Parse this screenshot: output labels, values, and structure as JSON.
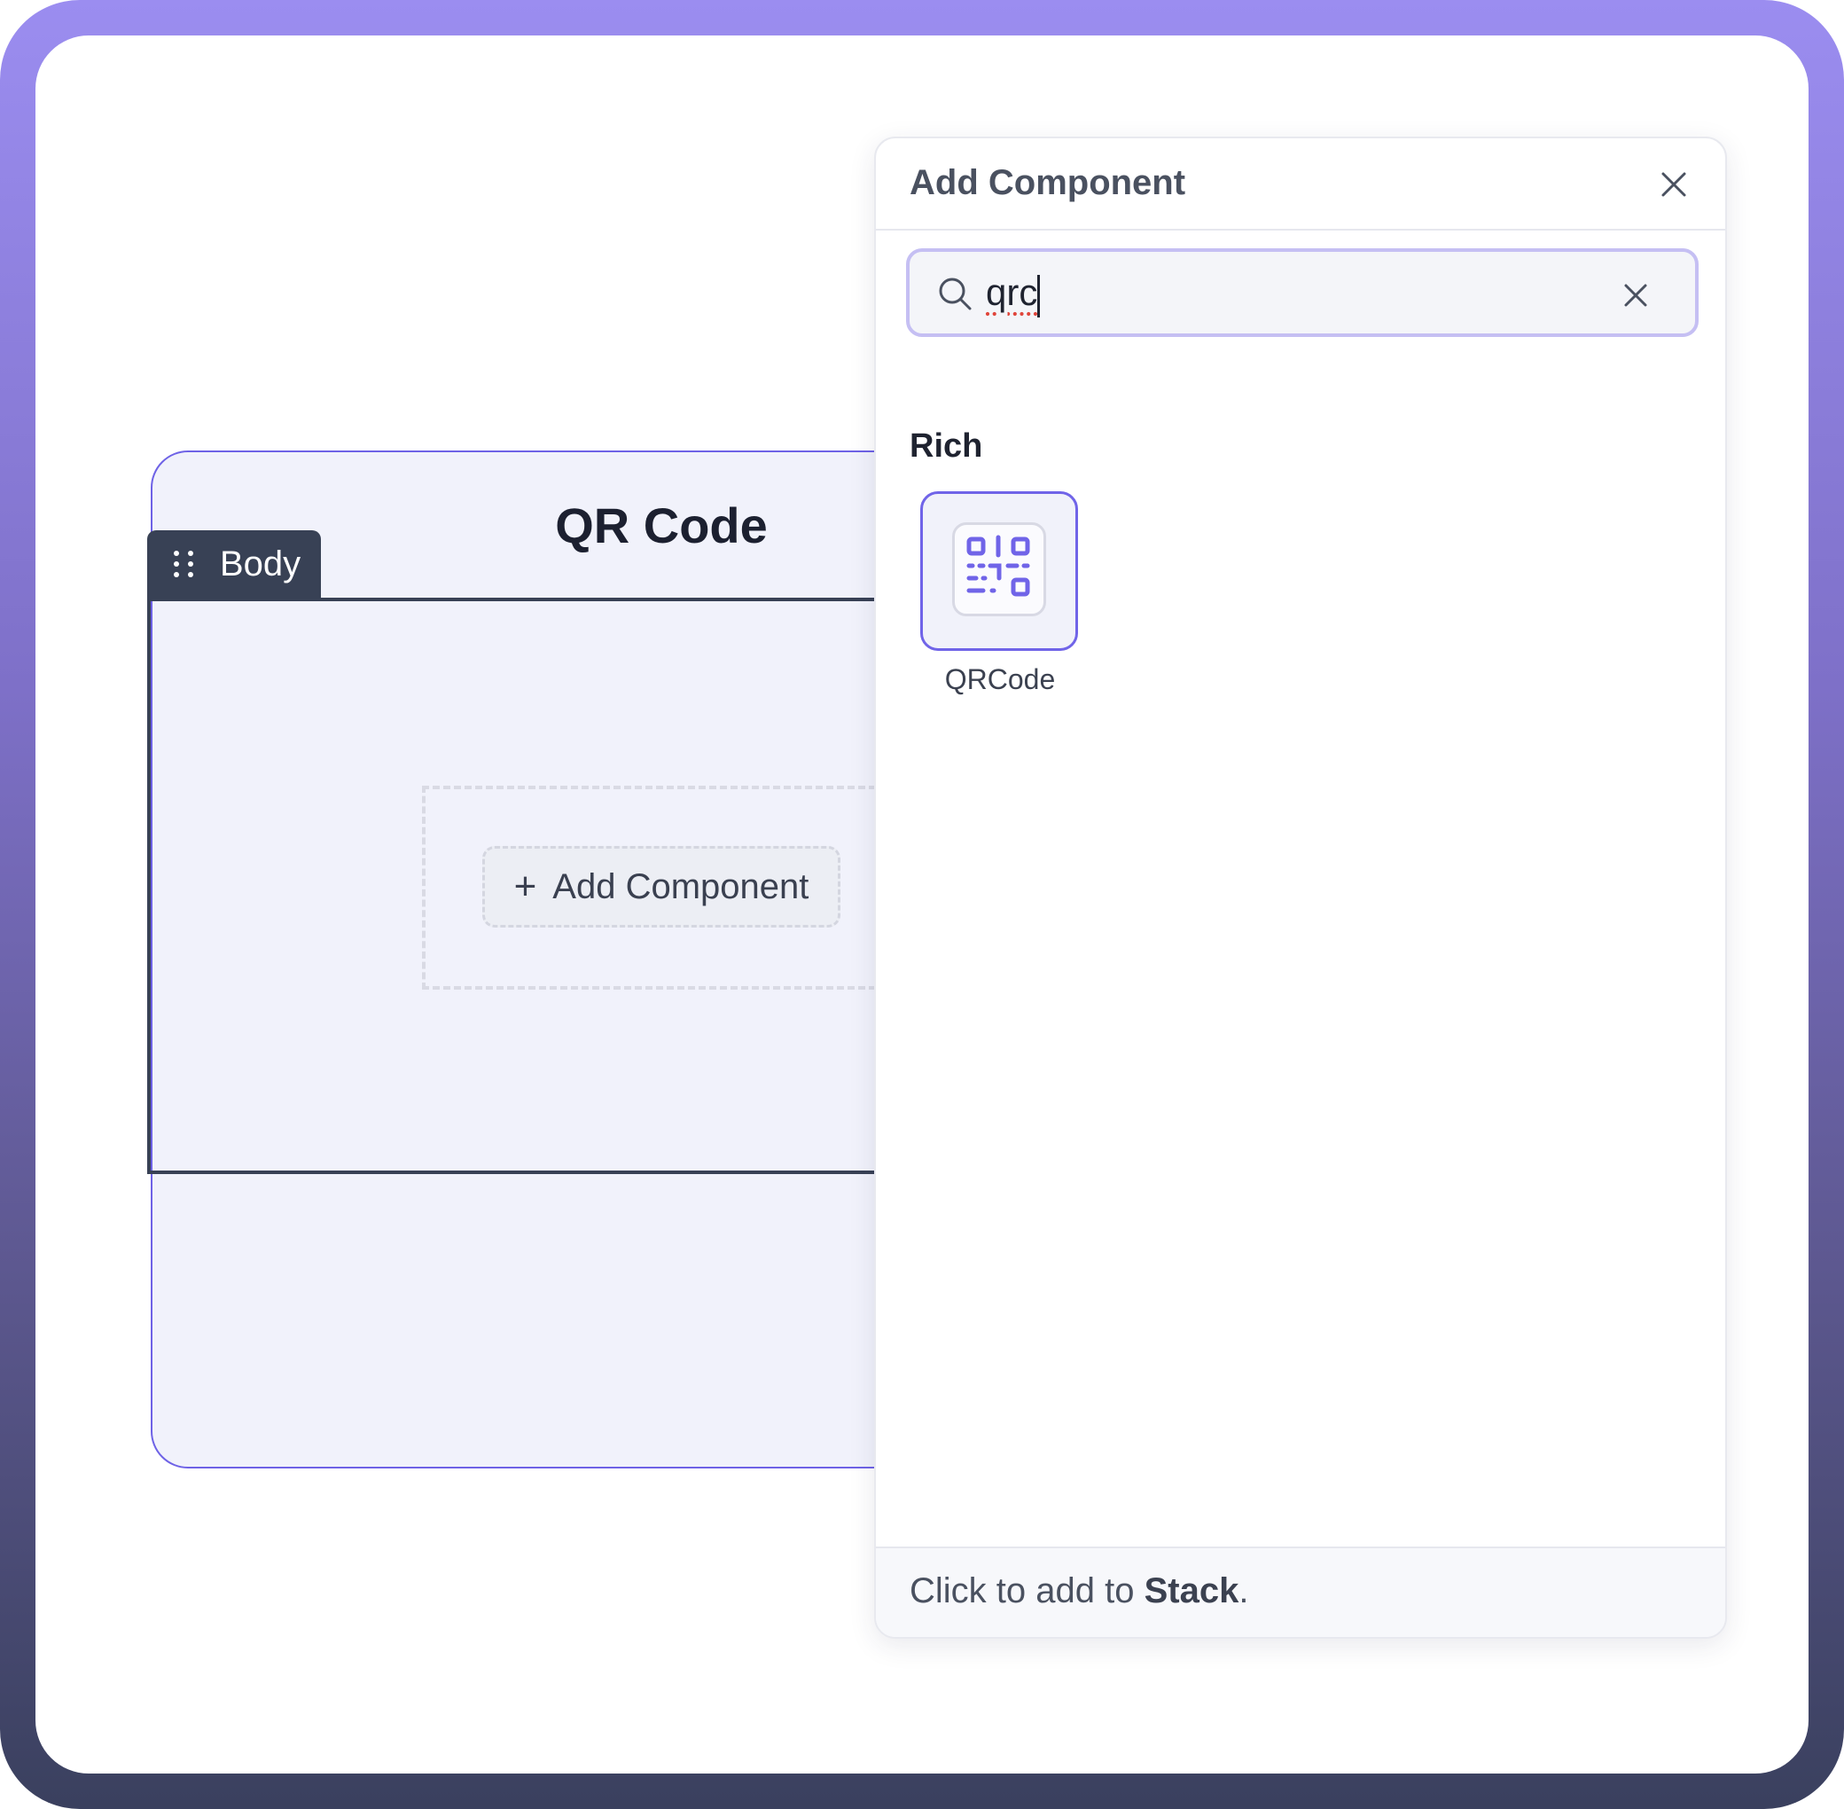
{
  "canvas": {
    "card_title": "QR Code",
    "body_tab_label": "Body",
    "add_component_label": "Add Component"
  },
  "panel": {
    "title": "Add Component",
    "search": {
      "value": "qrc",
      "placeholder": ""
    },
    "section_label": "Rich",
    "components": [
      {
        "label": "QRCode",
        "icon": "qr-code-icon"
      }
    ],
    "footer": {
      "prefix": "Click to add to ",
      "target": "Stack",
      "suffix": "."
    }
  },
  "colors": {
    "accent": "#7064e8",
    "frame_top": "#9b8df0",
    "frame_bottom": "#3a405e",
    "tab_dark": "#384155"
  }
}
